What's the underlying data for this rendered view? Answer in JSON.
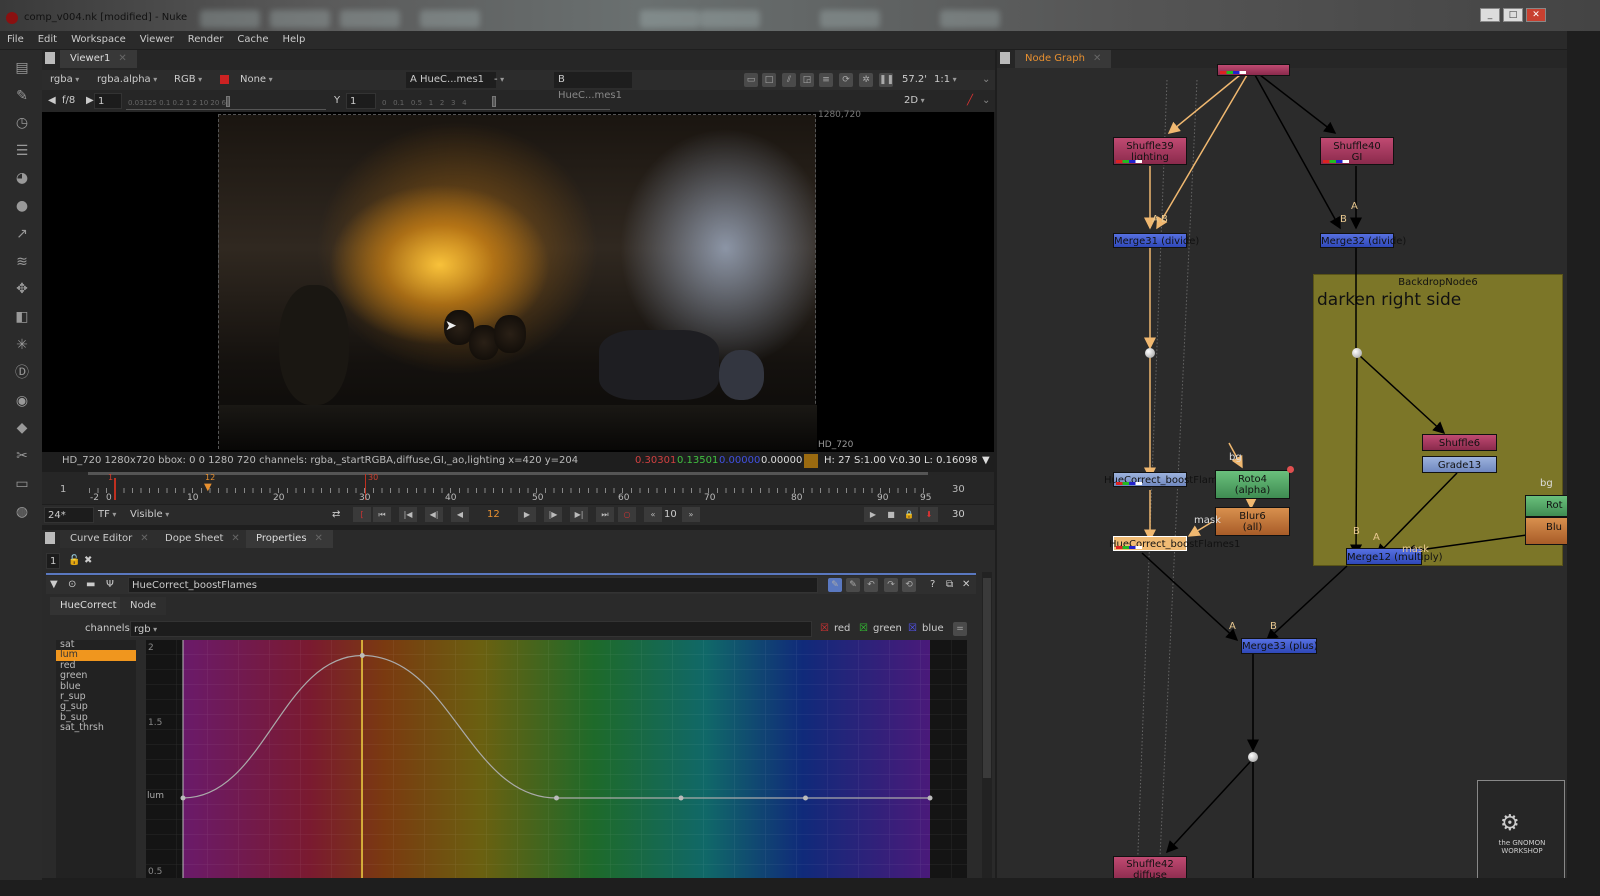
{
  "window": {
    "title": "comp_v004.nk [modified] - Nuke",
    "controls": [
      "_",
      "□",
      "✕"
    ]
  },
  "menu": [
    "File",
    "Edit",
    "Workspace",
    "Viewer",
    "Render",
    "Cache",
    "Help"
  ],
  "viewer": {
    "tab": "Viewer1",
    "channels": "rgba",
    "alpha_channel": "rgba.alpha",
    "colorspace": "RGB",
    "lut": "None",
    "input_a_label": "A",
    "input_a": "HueC...mes1",
    "input_a_op": "-",
    "input_b_label": "B",
    "input_b": "HueC...mes1",
    "zoom": "57.2'",
    "ratio": "1:1",
    "mode": "2D",
    "fstop": "f/8",
    "gain": "1",
    "gamma_label": "Y",
    "gamma": "1",
    "gain_ticks": "0.03125 0.1 0.2  1  2  10 20 60",
    "gamma_ticks": "0   0.1   0.5   1   2   3   4",
    "format_top": "1280,720",
    "format_label": "HD_720",
    "status": {
      "info": "HD_720 1280x720  bbox: 0 0 1280 720 channels: rgba,_startRGBA,diffuse,GI,_ao,lighting  x=420 y=204",
      "r": "0.30301",
      "g": "0.13501",
      "b": "0.00000",
      "a": "0.00000",
      "swatch": "#9a6a10",
      "hsv": "H: 27 S:1.00 V:0.30  L: 0.16098"
    }
  },
  "timeline": {
    "start": "1",
    "end": "30",
    "in_mark": "1",
    "current_mark": "12",
    "out_mark": "30",
    "ticks": [
      "-2",
      "0",
      "10",
      "20",
      "30",
      "40",
      "50",
      "60",
      "70",
      "80",
      "90",
      "95"
    ],
    "fps": "24*",
    "tf": "TF",
    "visible": "Visible",
    "frame": "12",
    "increment": "10",
    "end_frame": "30"
  },
  "panels": {
    "tabs": [
      "Curve Editor",
      "Dope Sheet",
      "Properties"
    ],
    "active": "Properties",
    "max_panels": "1"
  },
  "properties": {
    "node_name": "HueCorrect_boostFlames",
    "tabs": [
      "HueCorrect",
      "Node"
    ],
    "channels_label": "channels",
    "channels_value": "rgb",
    "checks": [
      "red",
      "green",
      "blue"
    ],
    "curves": [
      "sat",
      "lum",
      "red",
      "green",
      "blue",
      "r_sup",
      "g_sup",
      "b_sup",
      "sat_thrsh"
    ],
    "selected_curve": "lum",
    "y_ticks": [
      "2",
      "1.5",
      "lum",
      "0.5"
    ],
    "lum_curve_points": [
      [
        0,
        1
      ],
      [
        1.44,
        1.95
      ],
      [
        3,
        1
      ],
      [
        4,
        1
      ],
      [
        5,
        1
      ],
      [
        6,
        1
      ]
    ]
  },
  "nodegraph": {
    "tab": "Node Graph",
    "backdrop": {
      "name": "BackdropNode6",
      "note": "darken right side"
    },
    "nodes": {
      "shuffle39": "Shuffle39\nlighting",
      "shuffle39_a": "Shuffle39",
      "shuffle39_b": "lighting",
      "shuffle40_a": "Shuffle40",
      "shuffle40_b": "GI",
      "merge31": "Merge31 (divide)",
      "merge32": "Merge32 (divide)",
      "huecorrect": "HueCorrect_boostFlames",
      "huecorrect1": "HueCorrect_boostFlames1",
      "roto4_a": "Roto4",
      "roto4_b": "(alpha)",
      "blur6_a": "Blur6",
      "blur6_b": "(all)",
      "shuffle6": "Shuffle6",
      "grade13": "Grade13",
      "merge12": "Merge12 (multiply)",
      "merge33": "Merge33 (plus)",
      "shuffle42_a": "Shuffle42",
      "shuffle42_b": "diffuse",
      "rot_partial": "Rot",
      "blu_partial": "Blu"
    },
    "edge_labels": {
      "a": "A",
      "b": "B",
      "mask": "mask",
      "bg": "bg"
    },
    "watermark": "the GNOMON WORKSHOP"
  }
}
